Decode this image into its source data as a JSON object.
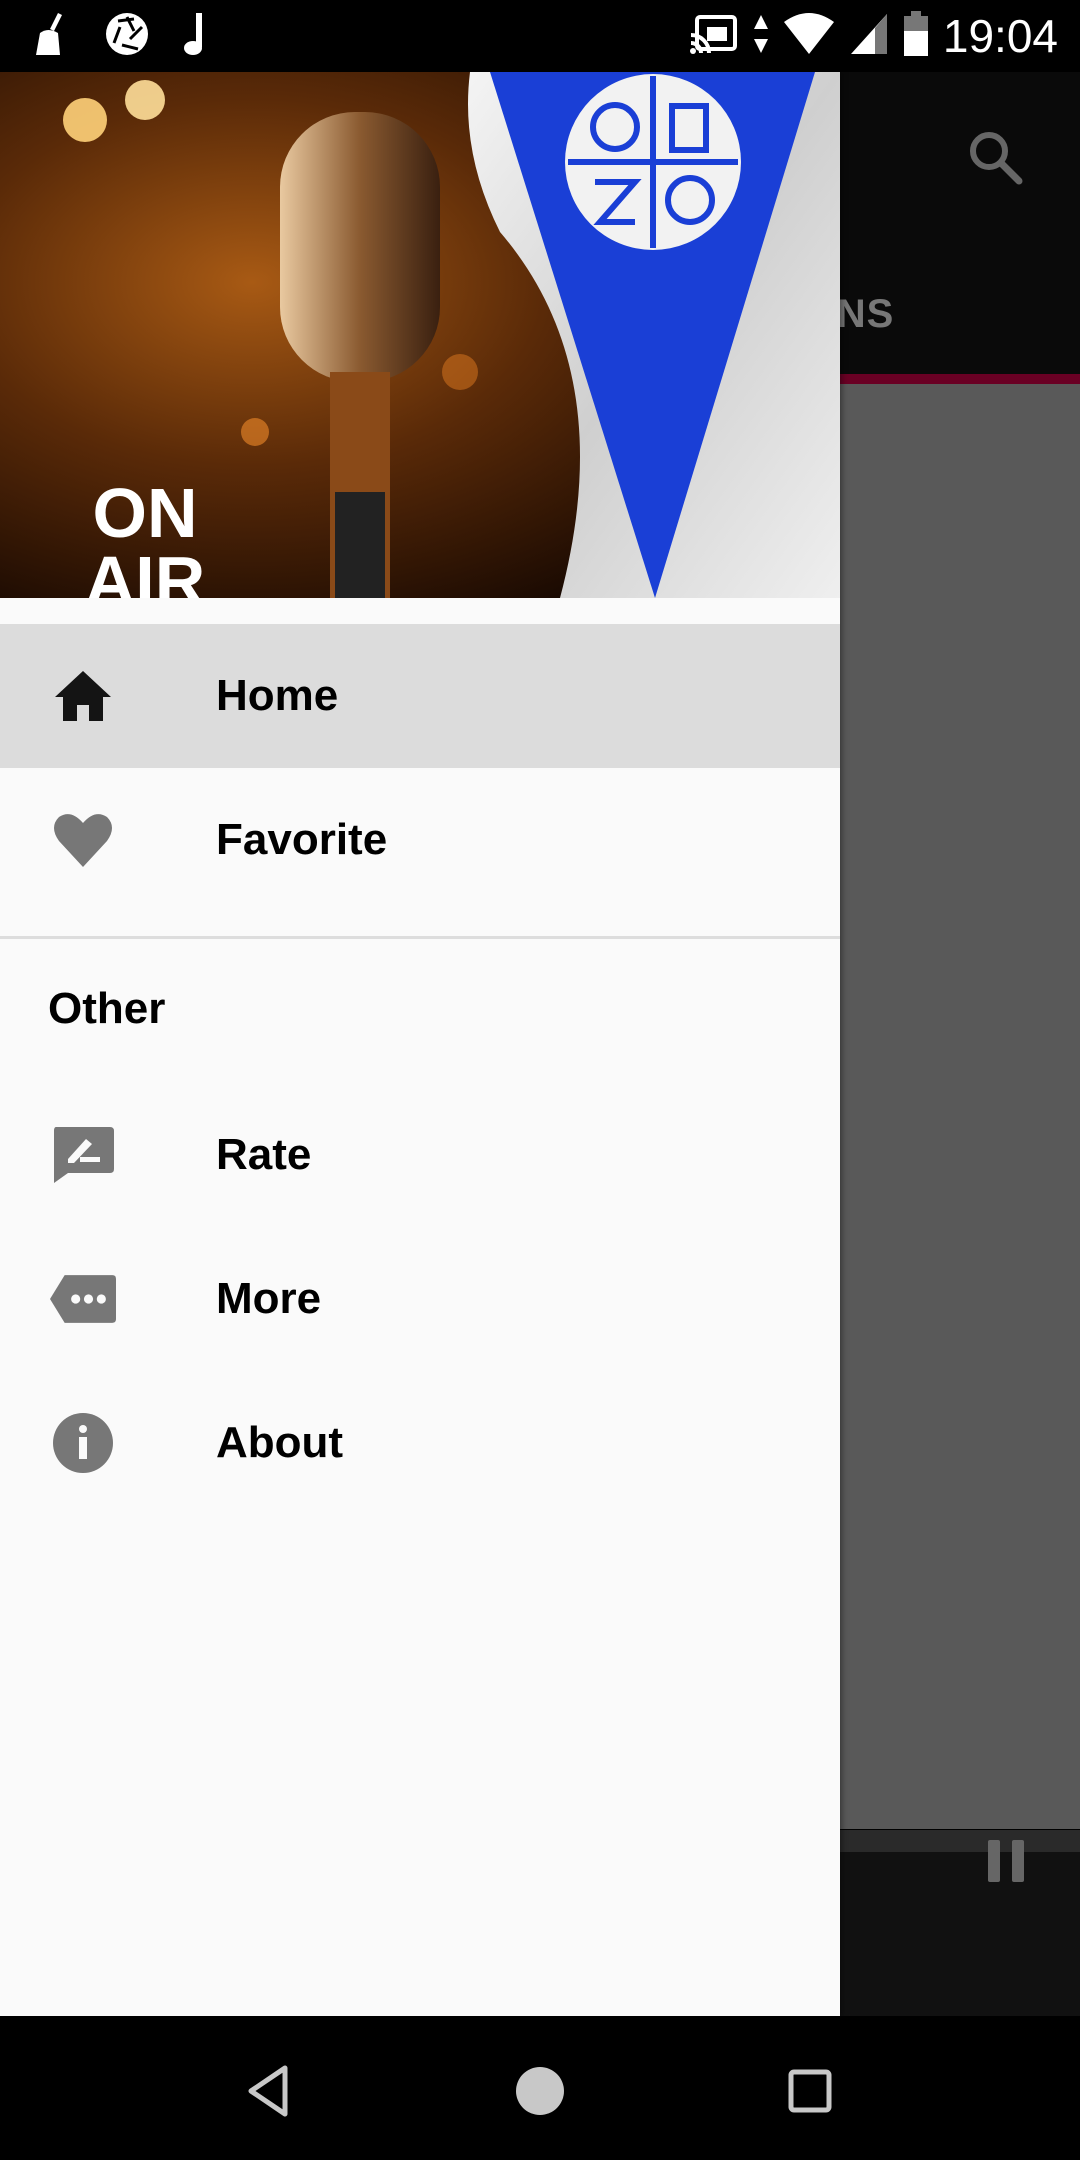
{
  "status_bar": {
    "time": "19:04",
    "left_icons": [
      "cleaner-icon",
      "aperture-icon",
      "music-note-icon"
    ],
    "right_icons": [
      "cast-icon",
      "data-arrows-icon",
      "wifi-icon",
      "signal-icon",
      "battery-icon"
    ]
  },
  "background_app": {
    "tab_label": "STATIONS",
    "accent_color": "#6a0024",
    "search_icon": "search-icon",
    "player_control": "pause-icon"
  },
  "drawer": {
    "header_image": {
      "text_line1": "ON",
      "text_line2": "AIR",
      "description": "microphone and blue pennant flag"
    },
    "primary_items": [
      {
        "label": "Home",
        "icon": "home-icon",
        "selected": true
      },
      {
        "label": "Favorite",
        "icon": "heart-icon",
        "selected": false
      }
    ],
    "section_title": "Other",
    "secondary_items": [
      {
        "label": "Rate",
        "icon": "rate-review-icon"
      },
      {
        "label": "More",
        "icon": "more-tag-icon"
      },
      {
        "label": "About",
        "icon": "info-icon"
      }
    ]
  },
  "nav_bar": {
    "buttons": [
      "back",
      "home",
      "recents"
    ]
  }
}
